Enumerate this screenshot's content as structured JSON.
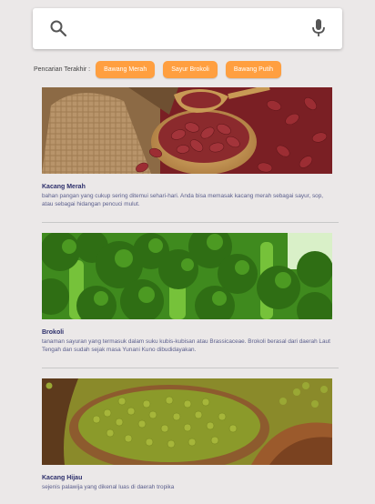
{
  "search": {
    "placeholder": "",
    "value": ""
  },
  "recent": {
    "label": "Pencarian Terakhir :",
    "chips": [
      "Bawang Merah",
      "Sayur Brokoli",
      "Bawang Putih"
    ]
  },
  "cards": [
    {
      "title": "Kacang Merah",
      "description": "bahan pangan yang cukup sering ditemui sehari-hari. Anda bisa memasak kacang merah sebagai sayur, sop, atau sebagai hidangan pencuci mulut.",
      "image": "kidney-beans-photo"
    },
    {
      "title": "Brokoli",
      "description": "tanaman sayuran yang termasuk dalam suku kubis-kubisan atau Brassicaceae. Brokoli berasal dari daerah Laut Tengah dan sudah sejak masa Yunani Kuno dibudidayakan.",
      "image": "broccoli-photo"
    },
    {
      "title": "Kacang Hijau",
      "description": "sejenis palawija yang dikenal luas di daerah tropika",
      "image": "mung-beans-photo"
    }
  ],
  "colors": {
    "accent": "#ff9f40",
    "title": "#2d2f6b",
    "background": "#ebe8e8"
  },
  "icons": [
    "search-icon",
    "mic-icon"
  ]
}
